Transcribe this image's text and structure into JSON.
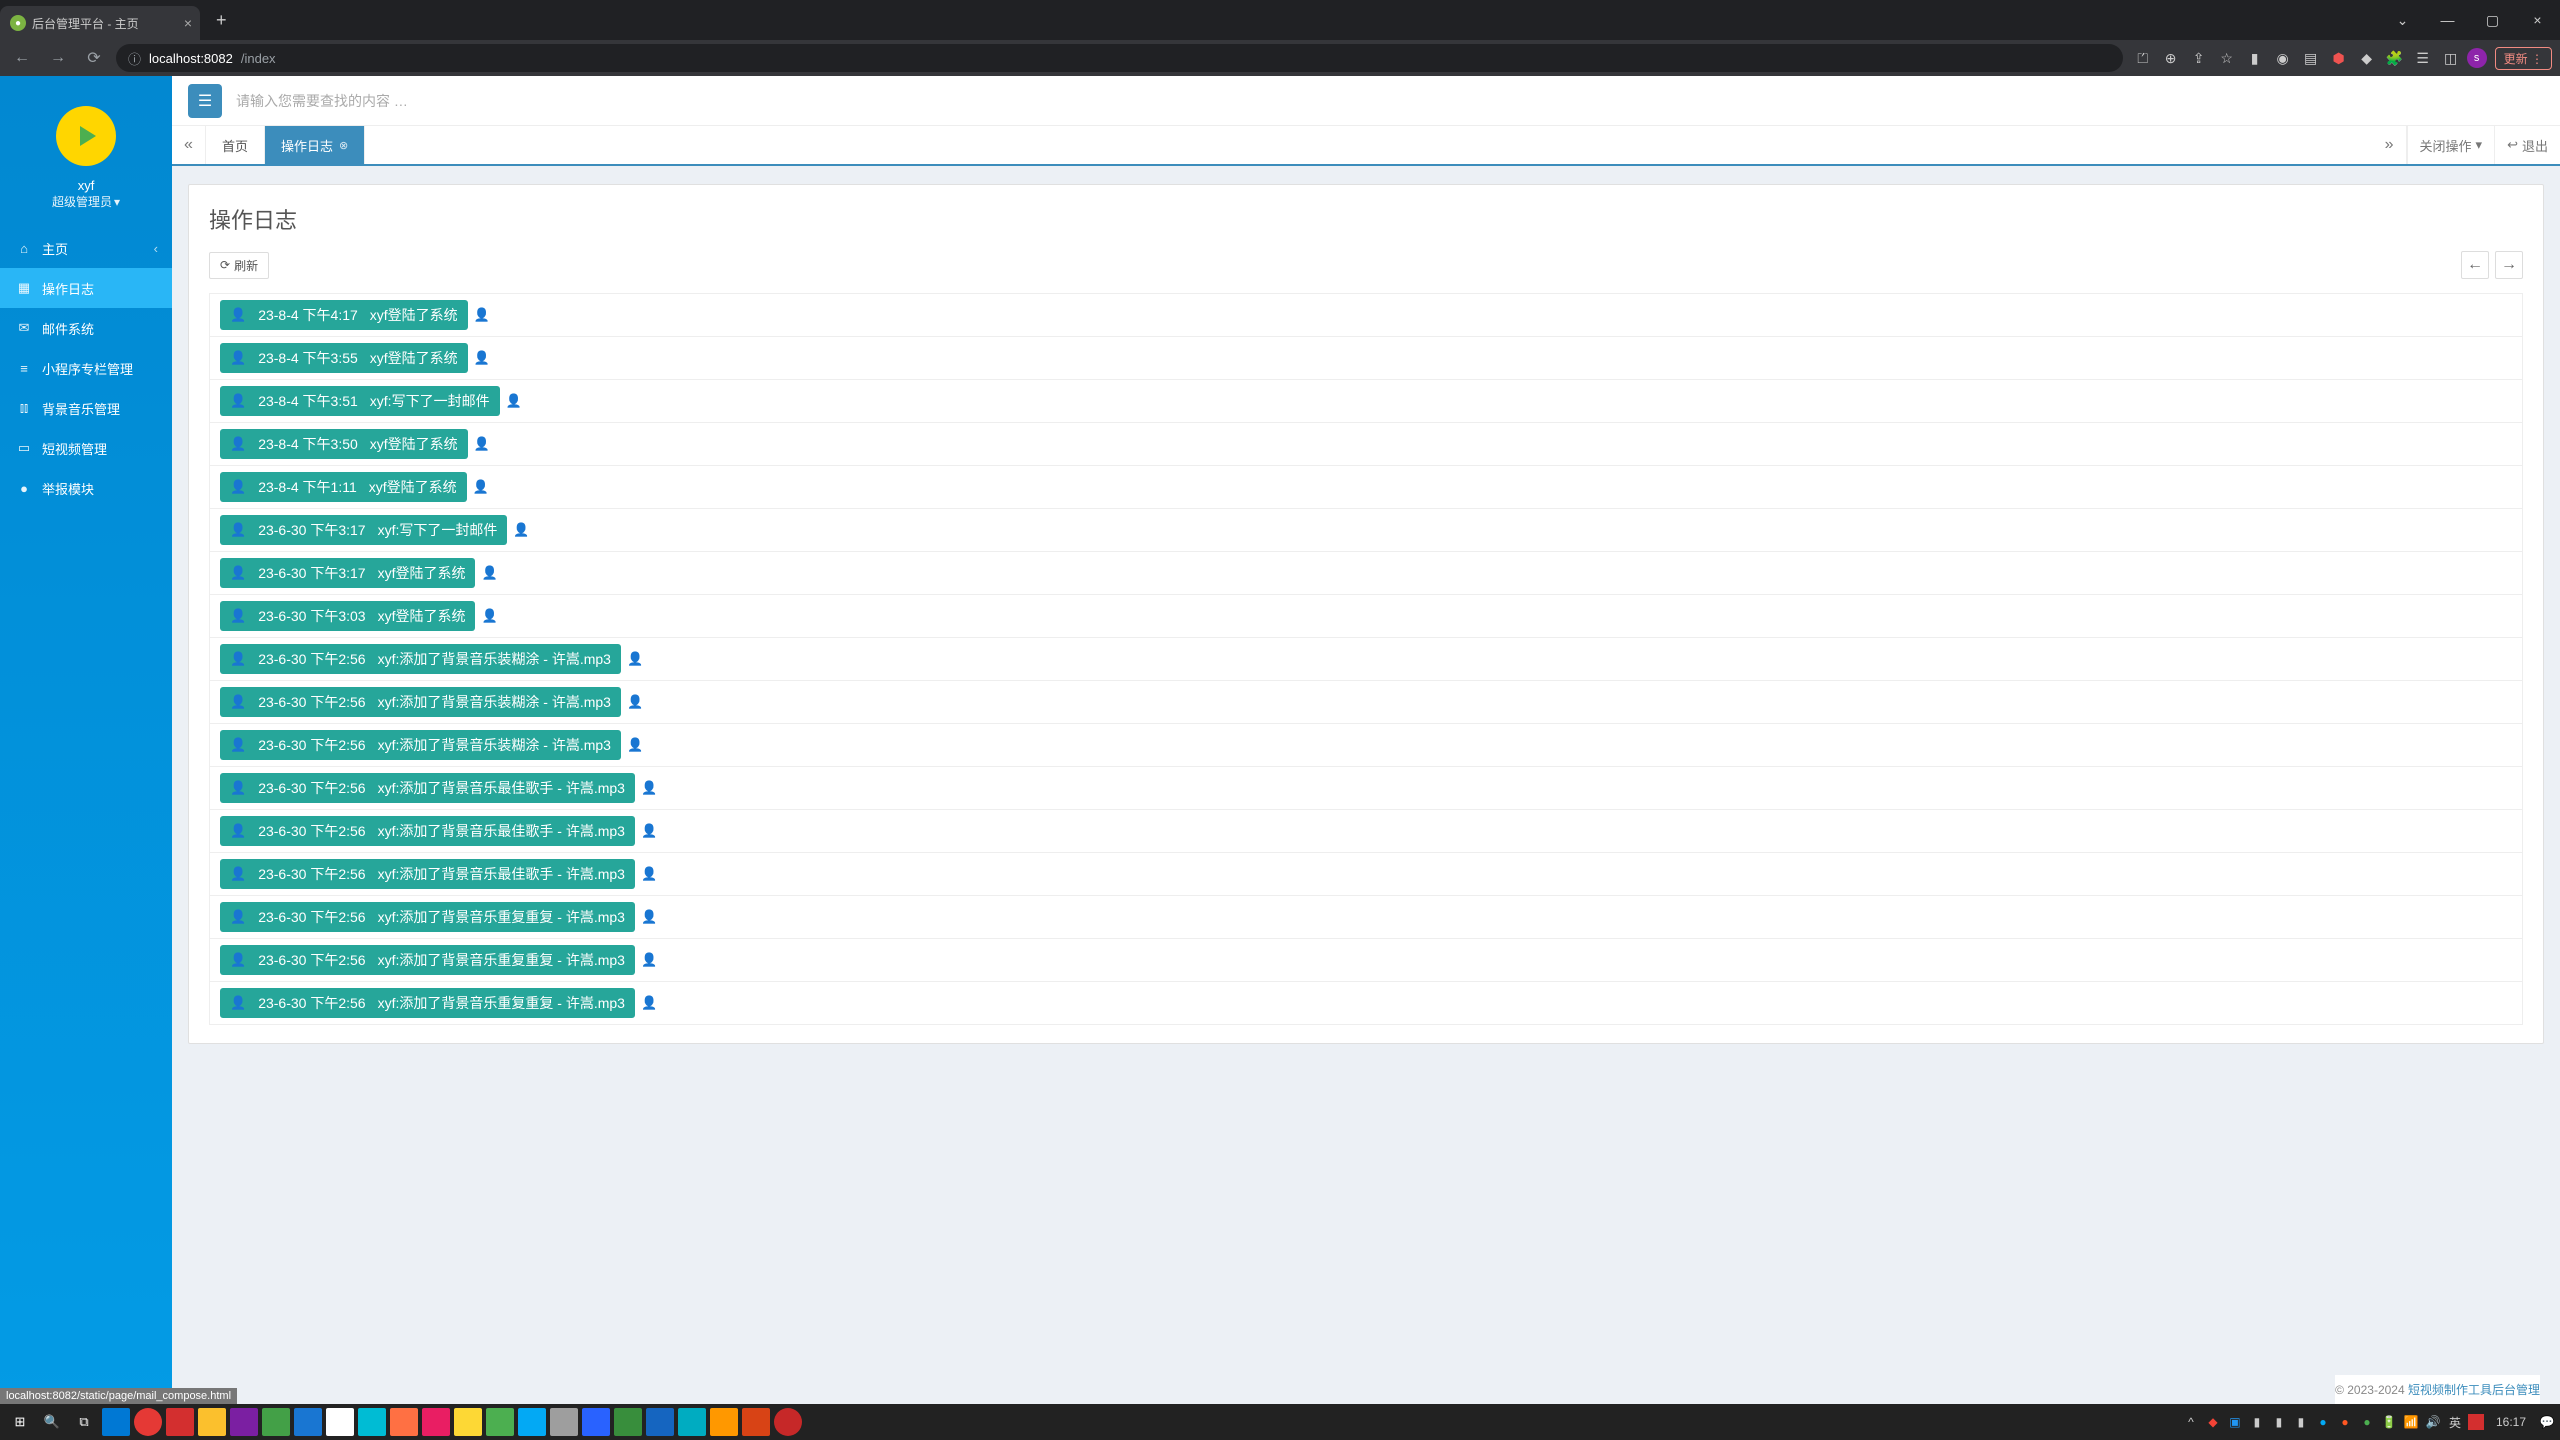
{
  "browser": {
    "tab_title": "后台管理平台 - 主页",
    "url_host": "localhost:8082",
    "url_path": "/index",
    "update_label": "更新",
    "profile_letter": "s"
  },
  "sidebar": {
    "user_name": "xyf",
    "user_role": "超级管理员",
    "items": [
      {
        "icon": "⌂",
        "label": "主页",
        "has_child": true
      },
      {
        "icon": "▦",
        "label": "操作日志",
        "active": true
      },
      {
        "icon": "✉",
        "label": "邮件系统"
      },
      {
        "icon": "≡",
        "label": "小程序专栏管理"
      },
      {
        "icon": "⫾⫾",
        "label": "背景音乐管理"
      },
      {
        "icon": "▭",
        "label": "短视频管理"
      },
      {
        "icon": "●",
        "label": "举报模块"
      }
    ]
  },
  "topbar": {
    "search_placeholder": "请输入您需要查找的内容 …"
  },
  "tabs": {
    "items": [
      {
        "label": "首页",
        "closable": false
      },
      {
        "label": "操作日志",
        "closable": true,
        "active": true
      }
    ],
    "close_ops": "关闭操作",
    "logout": "退出"
  },
  "page": {
    "title": "操作日志",
    "refresh": "刷新",
    "logs": [
      {
        "time": "23-8-4 下午4:17",
        "text": "xyf登陆了系统"
      },
      {
        "time": "23-8-4 下午3:55",
        "text": "xyf登陆了系统"
      },
      {
        "time": "23-8-4 下午3:51",
        "text": "xyf:写下了一封邮件"
      },
      {
        "time": "23-8-4 下午3:50",
        "text": "xyf登陆了系统"
      },
      {
        "time": "23-8-4 下午1:11",
        "text": "xyf登陆了系统"
      },
      {
        "time": "23-6-30 下午3:17",
        "text": "xyf:写下了一封邮件"
      },
      {
        "time": "23-6-30 下午3:17",
        "text": "xyf登陆了系统"
      },
      {
        "time": "23-6-30 下午3:03",
        "text": "xyf登陆了系统"
      },
      {
        "time": "23-6-30 下午2:56",
        "text": "xyf:添加了背景音乐装糊涂 - 许嵩.mp3"
      },
      {
        "time": "23-6-30 下午2:56",
        "text": "xyf:添加了背景音乐装糊涂 - 许嵩.mp3"
      },
      {
        "time": "23-6-30 下午2:56",
        "text": "xyf:添加了背景音乐装糊涂 - 许嵩.mp3"
      },
      {
        "time": "23-6-30 下午2:56",
        "text": "xyf:添加了背景音乐最佳歌手 - 许嵩.mp3"
      },
      {
        "time": "23-6-30 下午2:56",
        "text": "xyf:添加了背景音乐最佳歌手 - 许嵩.mp3"
      },
      {
        "time": "23-6-30 下午2:56",
        "text": "xyf:添加了背景音乐最佳歌手 - 许嵩.mp3"
      },
      {
        "time": "23-6-30 下午2:56",
        "text": "xyf:添加了背景音乐重复重复 - 许嵩.mp3"
      },
      {
        "time": "23-6-30 下午2:56",
        "text": "xyf:添加了背景音乐重复重复 - 许嵩.mp3"
      },
      {
        "time": "23-6-30 下午2:56",
        "text": "xyf:添加了背景音乐重复重复 - 许嵩.mp3"
      }
    ]
  },
  "footer": {
    "copyright": "© 2023-2024 ",
    "link": "短视频制作工具后台管理"
  },
  "statusbar": {
    "text": "localhost:8082/static/page/mail_compose.html"
  },
  "taskbar": {
    "ime": "英",
    "time": "16:17"
  }
}
